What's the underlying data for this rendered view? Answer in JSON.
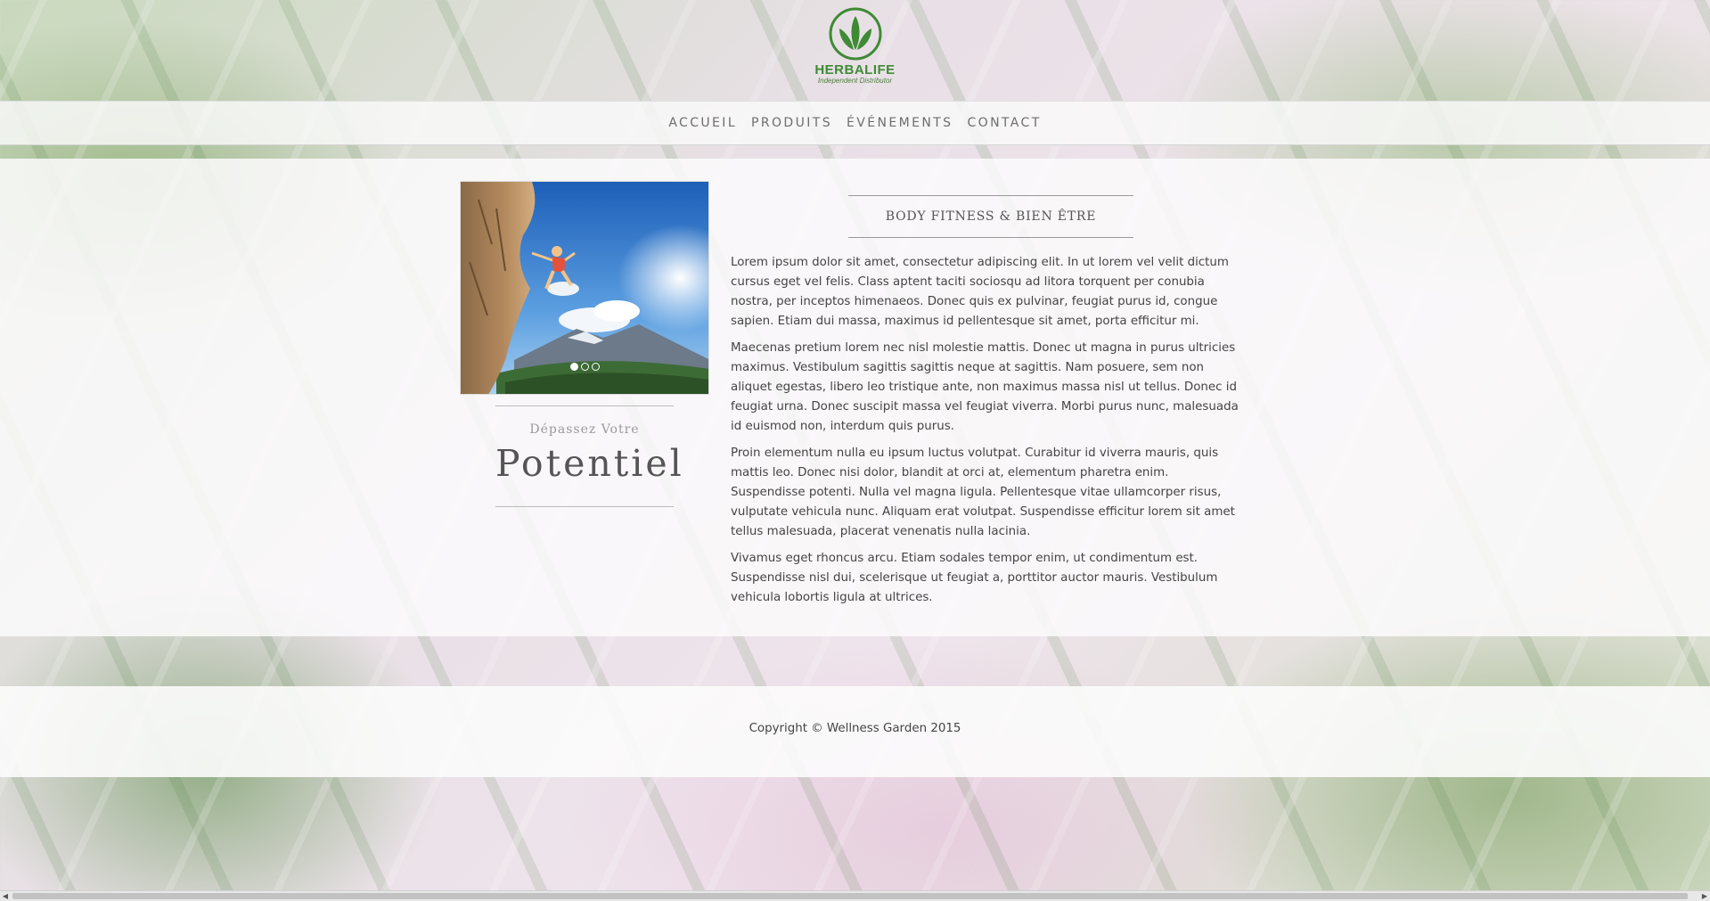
{
  "brand": {
    "name": "HERBALIFE",
    "tagline": "Independent Distributor",
    "color": "#3f8a35"
  },
  "nav": {
    "items": [
      {
        "label": "ACCUEIL"
      },
      {
        "label": "PRODUITS"
      },
      {
        "label": "ÉVÉNEMENTS"
      },
      {
        "label": "CONTACT"
      }
    ]
  },
  "slider": {
    "slide_count": 3,
    "active_index": 0
  },
  "promo": {
    "small": "Dépassez Votre",
    "big": "Potentiel"
  },
  "article": {
    "title": "BODY FITNESS & BIEN ÊTRE",
    "paragraphs": [
      "Lorem ipsum dolor sit amet, consectetur adipiscing elit. In ut lorem vel velit dictum cursus eget vel felis. Class aptent taciti sociosqu ad litora torquent per conubia nostra, per inceptos himenaeos. Donec quis ex pulvinar, feugiat purus id, congue sapien. Etiam dui massa, maximus id pellentesque sit amet, porta efficitur mi.",
      "Maecenas pretium lorem nec nisl molestie mattis. Donec ut magna in purus ultricies maximus. Vestibulum sagittis sagittis neque at sagittis. Nam posuere, sem non aliquet egestas, libero leo tristique ante, non maximus massa nisl ut tellus. Donec id feugiat urna. Donec suscipit massa vel feugiat viverra. Morbi purus nunc, malesuada id euismod non, interdum quis purus.",
      "Proin elementum nulla eu ipsum luctus volutpat. Curabitur id viverra mauris, quis mattis leo. Donec nisi dolor, blandit at orci at, elementum pharetra enim. Suspendisse potenti. Nulla vel magna ligula. Pellentesque vitae ullamcorper risus, vulputate vehicula nunc. Aliquam erat volutpat. Suspendisse efficitur lorem sit amet tellus malesuada, placerat venenatis nulla lacinia.",
      "Vivamus eget rhoncus arcu. Etiam sodales tempor enim, ut condimentum est. Suspendisse nisl dui, scelerisque ut feugiat a, porttitor auctor mauris. Vestibulum vehicula lobortis ligula at ultrices."
    ]
  },
  "footer": {
    "copyright": "Copyright © Wellness Garden 2015"
  },
  "icons": {
    "logo": "herbalife-leaf-icon",
    "scroll_left": "arrow-left-icon",
    "scroll_right": "arrow-right-icon"
  }
}
